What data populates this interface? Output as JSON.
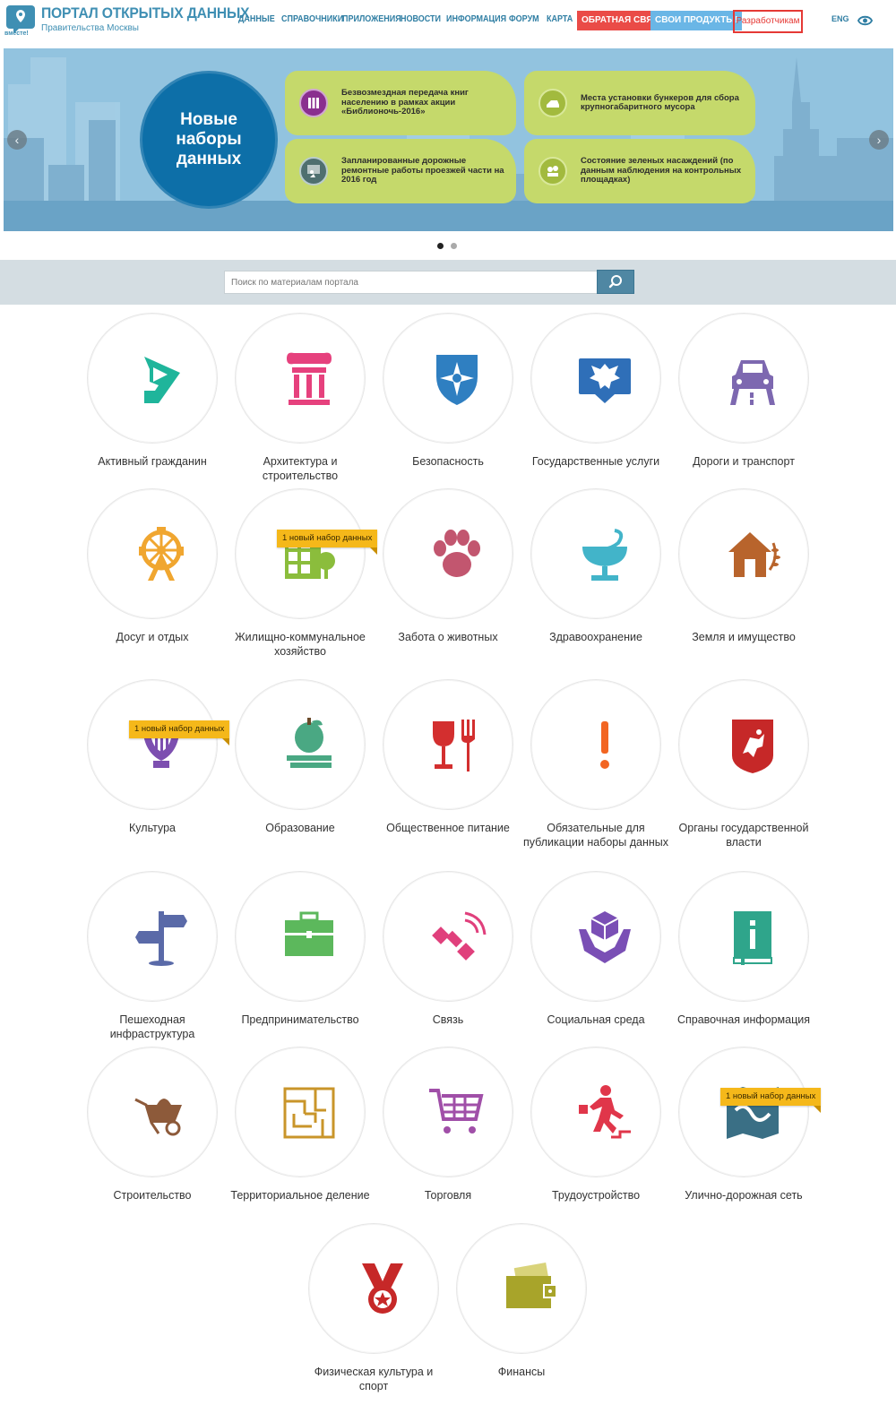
{
  "header": {
    "title": "ПОРТАЛ ОТКРЫТЫХ ДАННЫХ",
    "subtitle": "Правительства Москвы",
    "logo_text": "вместе!",
    "nav": [
      "ДАННЫЕ",
      "СПРАВОЧНИКИ",
      "ПРИЛОЖЕНИЯ",
      "НОВОСТИ",
      "ИНФОРМАЦИЯ",
      "ФОРУМ",
      "КАРТА"
    ],
    "feedback_button": "ОБРАТНАЯ СВЯЗЬ",
    "products_button": "СВОИ ПРОДУКТЫ!",
    "developers_button": "Разработчикам",
    "lang": "ENG",
    "colors": {
      "brand": "#3f8fb3",
      "red": "#ea4b47",
      "blue": "#6ab6e6"
    }
  },
  "banner": {
    "circle_text": "Новые\nнаборы\nданных",
    "cards": [
      {
        "text": "Безвозмездная передача книг населению в рамках акции «Библионочь-2016»",
        "icon": "books-icon"
      },
      {
        "text": "Места установки бункеров для сбора крупногабаритного мусора",
        "icon": "truck-icon"
      },
      {
        "text": "Запланированные дорожные ремонтные работы проезжей части на 2016 год",
        "icon": "roadwork-icon"
      },
      {
        "text": "Состояние зеленых насаждений (по данным наблюдения на контрольных площадках)",
        "icon": "plants-icon"
      }
    ],
    "prev_arrow": "‹",
    "next_arrow": "›",
    "active_slide": 1,
    "slide_count": 2
  },
  "search": {
    "placeholder": "Поиск по материалам портала"
  },
  "badge_text": "1 новый набор данных",
  "categories": [
    {
      "label": "Активный гражданин",
      "icon": "active-citizen-icon",
      "color": "#1fb59b"
    },
    {
      "label": "Архитектура и строительство",
      "icon": "column-icon",
      "color": "#e6417d"
    },
    {
      "label": "Безопасность",
      "icon": "shield-icon",
      "color": "#2f7fc1"
    },
    {
      "label": "Государственные услуги",
      "icon": "eagle-icon",
      "color": "#2f6fb8"
    },
    {
      "label": "Дороги и транспорт",
      "icon": "car-icon",
      "color": "#7d68b0"
    },
    {
      "label": "Досуг и отдых",
      "icon": "ferris-wheel-icon",
      "color": "#f0a630"
    },
    {
      "label": "Жилищно-коммунальное хозяйство",
      "icon": "building-icon",
      "color": "#8bbd3c",
      "badge": true
    },
    {
      "label": "Забота о животных",
      "icon": "paw-icon",
      "color": "#c2566f"
    },
    {
      "label": "Здравоохранение",
      "icon": "medicine-icon",
      "color": "#42b4c9"
    },
    {
      "label": "Земля и имущество",
      "icon": "house-icon",
      "color": "#b8642c"
    },
    {
      "label": "Культура",
      "icon": "lyre-icon",
      "color": "#7d4fb0",
      "badge": true
    },
    {
      "label": "Образование",
      "icon": "apple-books-icon",
      "color": "#4aa883"
    },
    {
      "label": "Общественное питание",
      "icon": "wine-fork-icon",
      "color": "#d32f2f"
    },
    {
      "label": "Обязательные для публикации наборы данных",
      "icon": "exclamation-icon",
      "color": "#f26522"
    },
    {
      "label": "Органы государственной власти",
      "icon": "moscow-crest-icon",
      "color": "#c62828"
    },
    {
      "label": "Пешеходная инфраструктура",
      "icon": "signpost-icon",
      "color": "#5a6aa8"
    },
    {
      "label": "Предпринимательство",
      "icon": "briefcase-icon",
      "color": "#5cb85c"
    },
    {
      "label": "Связь",
      "icon": "satellite-icon",
      "color": "#e0407c"
    },
    {
      "label": "Социальная среда",
      "icon": "hands-box-icon",
      "color": "#7a4fb5"
    },
    {
      "label": "Справочная информация",
      "icon": "info-book-icon",
      "color": "#2fa58b"
    },
    {
      "label": "Строительство",
      "icon": "wheelbarrow-icon",
      "color": "#8d5a3a"
    },
    {
      "label": "Территориальное деление",
      "icon": "maze-icon",
      "color": "#c9952a"
    },
    {
      "label": "Торговля",
      "icon": "cart-icon",
      "color": "#a04fa8"
    },
    {
      "label": "Трудоустройство",
      "icon": "running-man-icon",
      "color": "#e0364a"
    },
    {
      "label": "Улично-дорожная сеть",
      "icon": "road-map-icon",
      "color": "#3a6f85",
      "badge": true
    },
    {
      "label": "Физическая культура и спорт",
      "icon": "medal-icon",
      "color": "#c62828"
    },
    {
      "label": "Финансы",
      "icon": "wallet-icon",
      "color": "#a8a42a"
    }
  ]
}
